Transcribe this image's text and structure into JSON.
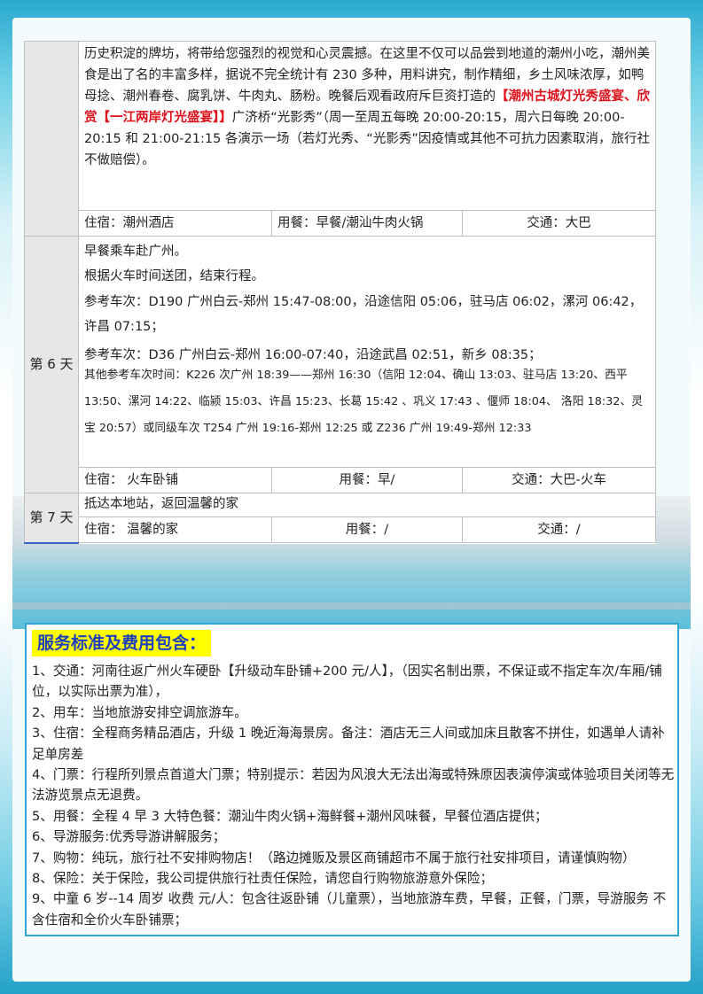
{
  "day5": {
    "text_before_red": "历史积淀的牌坊，将带给您强烈的视觉和心灵震撼。在这里不仅可以品尝到地道的潮州小吃，潮州美食是出了名的丰富多样，据说不完全统计有 230 多种，用料讲究，制作精细，乡土风味浓厚，如鸭母捻、潮州春卷、腐乳饼、牛肉丸、肠粉。晚餐后观看政府斥巨资打造的",
    "red_text": "【潮州古城灯光秀盛宴、欣赏【一江两岸灯光盛宴】】",
    "text_after_red": "广济桥“光影秀”（周一至周五每晚 20:00-20:15，周六日每晚 20:00-20:15 和 21:00-21:15 各演示一场（若灯光秀、“光影秀”因疫情或其他不可抗力因素取消，旅行社不做赔偿）。",
    "stay": "住宿：潮州酒店",
    "meal": "用餐：早餐/潮汕牛肉火锅",
    "transport": "交通：大巴"
  },
  "day6": {
    "label": "第 6 天",
    "line1": "早餐乘车赴广州。",
    "line2": "根据火车时间送团，结束行程。",
    "line3": "参考车次：D190  广州白云-郑州   15:47-08:00，沿途信阳 05:06，驻马店 06:02，漯河 06:42，许昌 07:15；",
    "line4": "参考车次：D36  广州白云-郑州   16:00-07:40，沿途武昌 02:51，新乡  08:35；",
    "line5": "其他参考车次时间：K226 次广州 18:39——郑州 16:30（信阳 12:04、确山 13:03、驻马店 13:20、西平 13:50、漯河 14:22、临颍 15:03、许昌 15:23、长葛 15:42  、巩义 17:43   、偃师 18:04、  洛阳 18:32、灵宝 20:57）或同级车次 T254 广州 19:16-郑州 12:25 或 Z236 广州 19:49-郑州 12:33",
    "stay": "住宿：   火车卧铺",
    "meal": "用餐：早/",
    "transport": "交通：大巴-火车"
  },
  "day7": {
    "label": "第 7 天",
    "line1": "抵达本地站，返回温馨的家",
    "stay": "住宿：   温馨的家",
    "meal": "用餐：/",
    "transport": "交通：/"
  },
  "service": {
    "title": "服务标准及费用包含：",
    "items": [
      "1、交通：河南往返广州火车硬卧【升级动车卧铺+200 元/人】，（因实名制出票，不保证或不指定车次/车厢/铺位，以实际出票为准），",
      "2、用车：当地旅游安排空调旅游车。",
      "3、住宿：全程商务精品酒店，升级 1 晚近海海景房。备注：酒店无三人间或加床且散客不拼住，如遇单人请补足单房差",
      "4、门票：行程所列景点首道大门票；特别提示：若因为风浪大无法出海或特殊原因表演停演或体验项目关闭等无法游览景点无退费。",
      "5、用餐：全程 4 早 3 大特色餐：潮汕牛肉火锅+海鲜餐+潮州风味餐，早餐位酒店提供；",
      "6、导游服务:优秀导游讲解服务；",
      "7、购物：纯玩，旅行社不安排购物店！（路边摊贩及景区商铺超市不属于旅行社安排项目，请谨慎购物）",
      "8、保险：关于保险，我公司提供旅行社责任保险，请您自行购物旅游意外保险；",
      "9、中童 6 岁--14 周岁  收费       元/人：包含往返卧铺（儿童票），当地旅游车费，早餐，正餐，门票，导游服务    不含住宿和全价火车卧铺票；"
    ]
  }
}
